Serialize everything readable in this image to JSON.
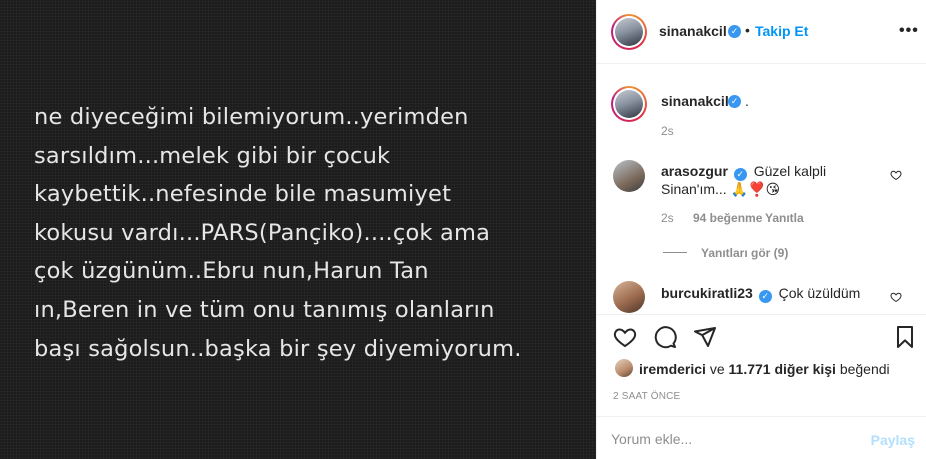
{
  "post": {
    "text_lines": [
      "ne diyeceğimi bilemiyorum..yerimden",
      "sarsıldım...melek gibi bir çocuk",
      "kaybettik..nefesinde bile masumiyet",
      "kokusu vardı...PARS(Pançiko)....çok ama",
      "çok üzgünüm..Ebru nun,Harun Tan",
      "ın,Beren in ve tüm onu tanımış olanların",
      "başı sağolsun..başka bir şey diyemiyorum."
    ]
  },
  "header": {
    "username": "sinanakcil",
    "verified_glyph": "✓",
    "separator": "•",
    "follow_label": "Takip Et",
    "more_label": "•••"
  },
  "caption": {
    "username": "sinanakcil",
    "text": ".",
    "time": "2s"
  },
  "comments": [
    {
      "username": "arasozgur",
      "text": "Güzel kalpli Sinan'ım... 🙏❣️😘",
      "time": "2s",
      "likes": "94 beğenme",
      "reply_label": "Yanıtla",
      "view_replies": "Yanıtları gör (9)"
    },
    {
      "username": "burcukiratli23",
      "text": "Çok üzüldüm"
    }
  ],
  "likes": {
    "user": "iremderici",
    "connector": "ve",
    "others": "11.771 diğer kişi",
    "suffix": "beğendi"
  },
  "post_time": "2 SAAT ÖNCE",
  "add_comment": {
    "placeholder": "Yorum ekle...",
    "post_label": "Paylaş"
  },
  "icons": {
    "like": "heart-icon",
    "comment": "comment-icon",
    "share": "share-icon",
    "save": "bookmark-icon",
    "more": "more-icon"
  },
  "colors": {
    "accent": "#0095f6",
    "verified": "#3897f0",
    "post_bg": "#1c1c1c",
    "post_text": "#e6e6e6",
    "muted": "#8e8e8e"
  }
}
